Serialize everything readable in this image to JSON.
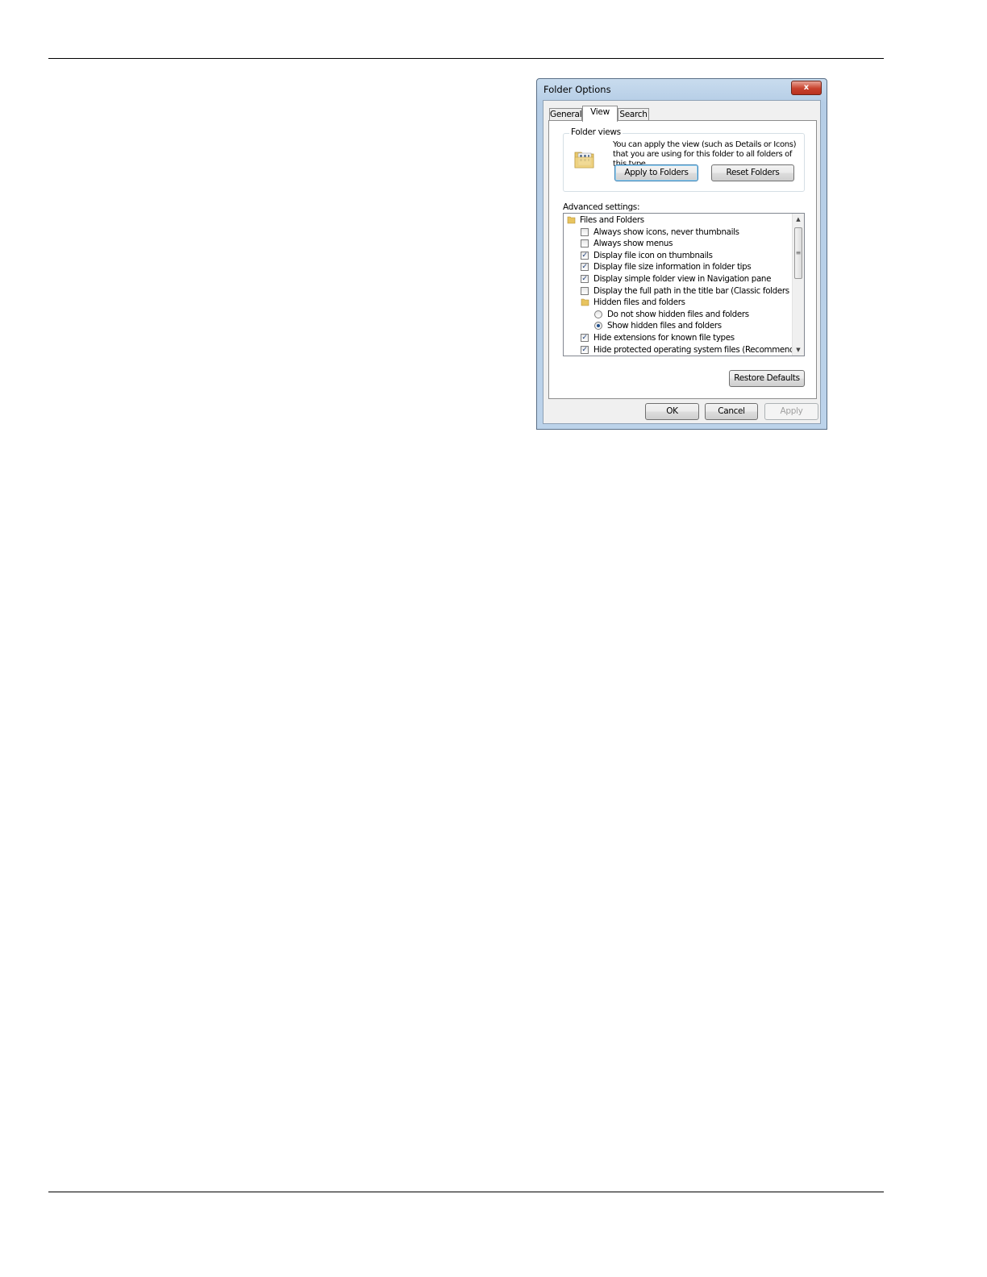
{
  "dialog": {
    "title": "Folder Options",
    "close_label": "x"
  },
  "tabs": [
    {
      "label": "General"
    },
    {
      "label": "View"
    },
    {
      "label": "Search"
    }
  ],
  "folder_views": {
    "group_label": "Folder views",
    "description": "You can apply the view (such as Details or Icons) that you are using for this folder to all folders of this type.",
    "apply_label": "Apply to Folders",
    "reset_label": "Reset Folders"
  },
  "advanced": {
    "label": "Advanced settings:",
    "items": [
      {
        "kind": "folder",
        "label": "Files and Folders"
      },
      {
        "kind": "checkbox",
        "checked": false,
        "label": "Always show icons, never thumbnails"
      },
      {
        "kind": "checkbox",
        "checked": false,
        "label": "Always show menus"
      },
      {
        "kind": "checkbox",
        "checked": true,
        "label": "Display file icon on thumbnails"
      },
      {
        "kind": "checkbox",
        "checked": true,
        "label": "Display file size information in folder tips"
      },
      {
        "kind": "checkbox",
        "checked": true,
        "label": "Display simple folder view in Navigation pane"
      },
      {
        "kind": "checkbox",
        "checked": false,
        "label": "Display the full path in the title bar (Classic folders only)"
      },
      {
        "kind": "folder",
        "label": "Hidden files and folders"
      },
      {
        "kind": "radio",
        "checked": false,
        "label": "Do not show hidden files and folders"
      },
      {
        "kind": "radio",
        "checked": true,
        "label": "Show hidden files and folders"
      },
      {
        "kind": "checkbox",
        "checked": true,
        "label": "Hide extensions for known file types"
      },
      {
        "kind": "checkbox",
        "checked": true,
        "label": "Hide protected operating system files (Recommended)"
      }
    ],
    "restore_label": "Restore Defaults"
  },
  "footer": {
    "ok_label": "OK",
    "cancel_label": "Cancel",
    "apply_label": "Apply"
  },
  "colors": {
    "checkmark": "#1d3f7a",
    "focused_border": "#3c7fb1",
    "close_button": "#c8412d"
  }
}
